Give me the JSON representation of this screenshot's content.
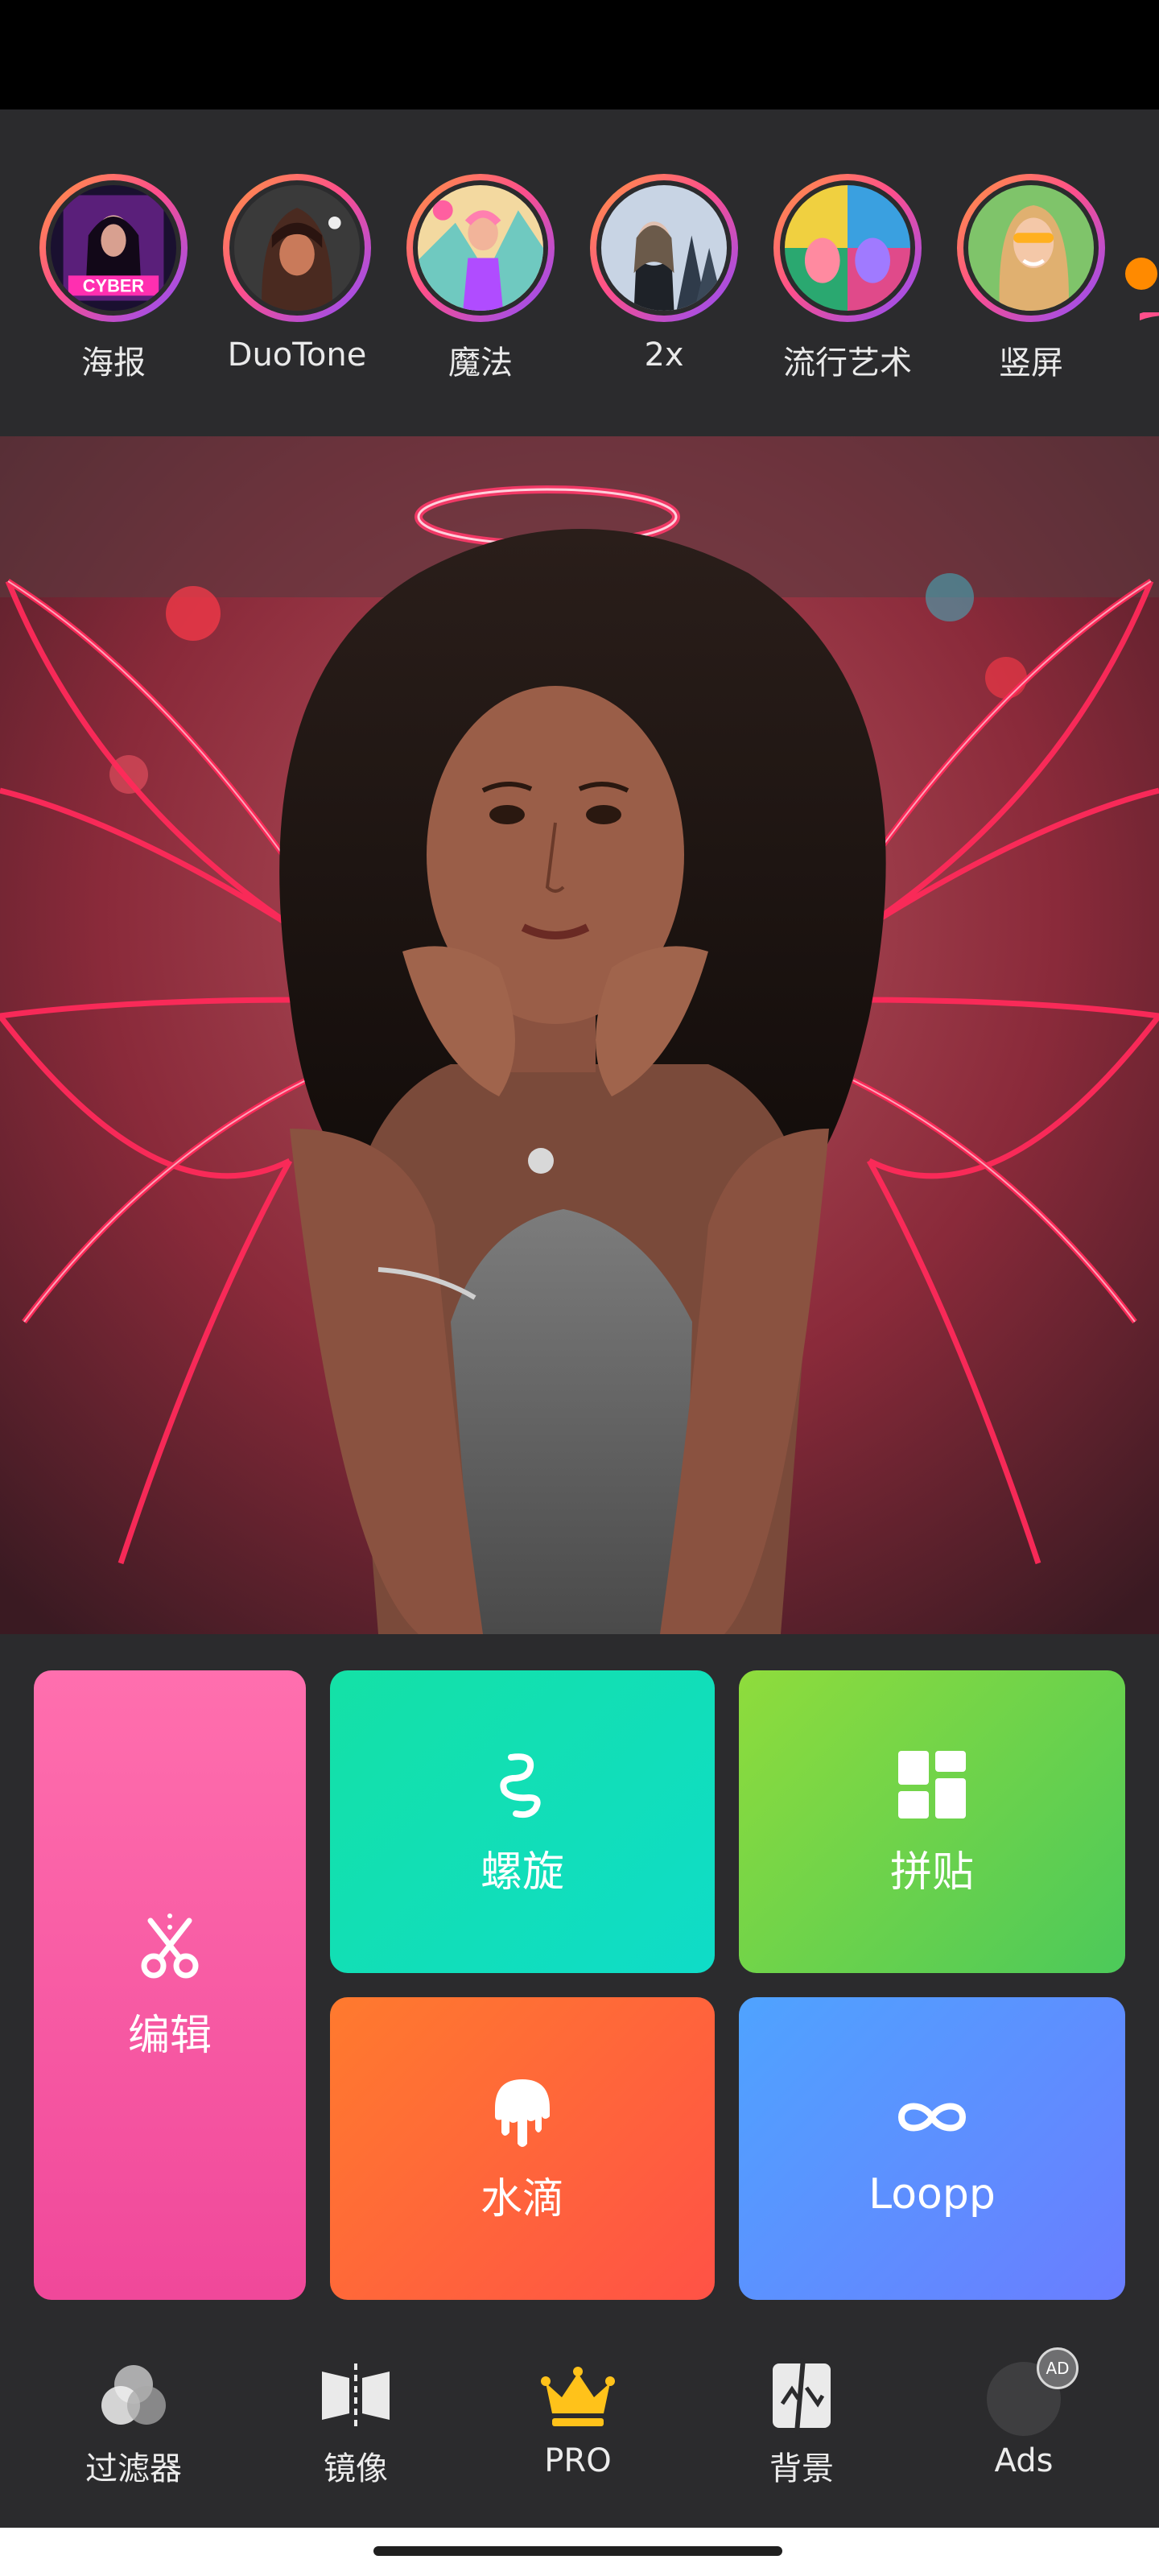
{
  "stories": [
    {
      "label": "海报",
      "icon": "poster-thumbnail"
    },
    {
      "label": "DuoTone",
      "icon": "duotone-thumbnail"
    },
    {
      "label": "魔法",
      "icon": "magic-thumbnail"
    },
    {
      "label": "2x",
      "icon": "2x-thumbnail"
    },
    {
      "label": "流行艺术",
      "icon": "pop-art-thumbnail"
    },
    {
      "label": "竖屏",
      "icon": "portrait-thumbnail"
    }
  ],
  "story_thumb_text": "CYBER",
  "tiles": {
    "edit": "编辑",
    "spiral": "螺旋",
    "collage": "拼贴",
    "drip": "水滴",
    "loopp": "Loopp"
  },
  "nav": {
    "filter": "过滤器",
    "mirror": "镜像",
    "pro": "PRO",
    "background": "背景",
    "ads": "Ads",
    "ad_badge": "AD"
  },
  "colors": {
    "accent_orange": "#ff8a00",
    "pro_crown": "#ffc21a",
    "background": "#2b2b2d"
  }
}
